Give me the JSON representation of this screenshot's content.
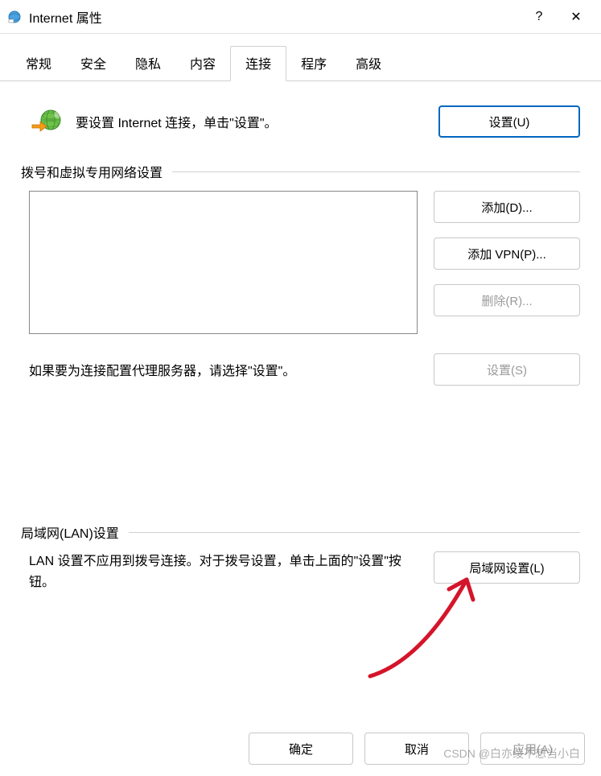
{
  "window": {
    "title": "Internet 属性",
    "help_symbol": "?",
    "close_symbol": "✕"
  },
  "tabs": {
    "items": [
      {
        "label": "常规",
        "active": false
      },
      {
        "label": "安全",
        "active": false
      },
      {
        "label": "隐私",
        "active": false
      },
      {
        "label": "内容",
        "active": false
      },
      {
        "label": "连接",
        "active": true
      },
      {
        "label": "程序",
        "active": false
      },
      {
        "label": "高级",
        "active": false
      }
    ]
  },
  "setup": {
    "text": "要设置 Internet 连接，单击\"设置\"。",
    "button": "设置(U)"
  },
  "dial": {
    "section_label": "拨号和虚拟专用网络设置",
    "add_button": "添加(D)...",
    "add_vpn_button": "添加 VPN(P)...",
    "remove_button": "删除(R)...",
    "proxy_text": "如果要为连接配置代理服务器，请选择\"设置\"。",
    "settings_button": "设置(S)"
  },
  "lan": {
    "section_label": "局域网(LAN)设置",
    "text": "LAN 设置不应用到拨号连接。对于拨号设置，单击上面的\"设置\"按钮。",
    "button": "局域网设置(L)"
  },
  "footer": {
    "ok": "确定",
    "cancel": "取消",
    "apply": "应用(A)"
  },
  "watermark": "CSDN @白亦绫不想当小白"
}
